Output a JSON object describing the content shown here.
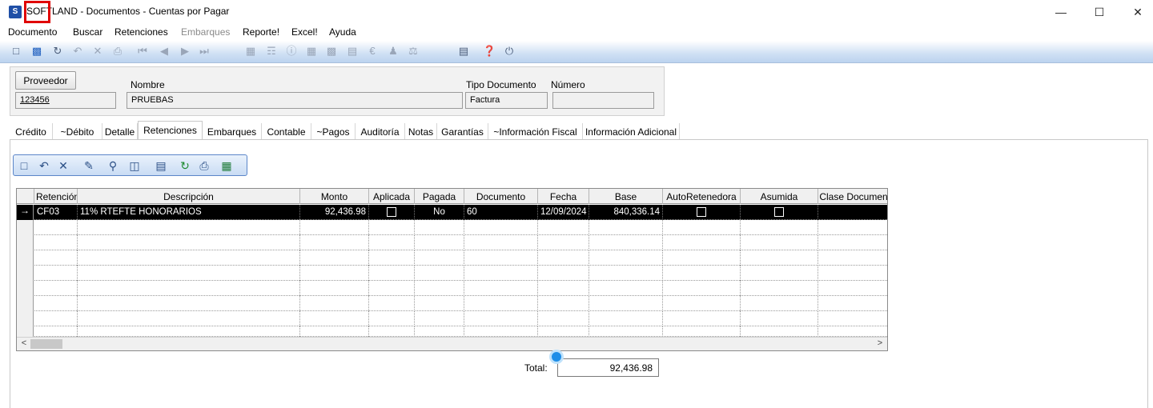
{
  "window": {
    "title": "SOFTLAND - Documentos - Cuentas por Pagar",
    "app_icon": "S",
    "controls": {
      "minimize": "—",
      "maximize": "☐",
      "close": "✕"
    }
  },
  "menu": [
    "Documento",
    "Buscar",
    "Retenciones",
    "Embarques",
    "Reporte!",
    "Excel!",
    "Ayuda"
  ],
  "toolbar_icons": [
    "new-document-icon",
    "save-icon",
    "refresh-icon",
    "undo-icon",
    "delete-icon",
    "print-preview-icon",
    "first-record-icon",
    "previous-record-icon",
    "next-record-icon",
    "last-record-icon",
    "calculator-icon",
    "tree-icon",
    "info-icon",
    "grid-icon",
    "table-icon",
    "note-icon",
    "money-icon",
    "user-icon",
    "scale-icon",
    "chart-icon",
    "help-icon",
    "power-icon"
  ],
  "header": {
    "proveedor_button": "Proveedor",
    "proveedor_value": "123456",
    "nombre_label": "Nombre",
    "nombre_value": "PRUEBAS",
    "tipo_label": "Tipo Documento",
    "tipo_value": "Factura",
    "numero_label": "Número",
    "numero_value": ""
  },
  "tabs": [
    "Crédito",
    "~Débito",
    "Detalle",
    "Retenciones",
    "Embarques",
    "Contable",
    "~Pagos",
    "Auditoría",
    "Notas",
    "Garantías",
    "~Información Fiscal",
    "Información Adicional"
  ],
  "active_tab": "Retenciones",
  "grid": {
    "columns": [
      "Retención",
      "Descripción",
      "Monto",
      "Aplicada",
      "Pagada",
      "Documento",
      "Fecha",
      "Base",
      "AutoRetenedora",
      "Asumida",
      "Clase Documen"
    ],
    "rows": [
      {
        "marker": "→",
        "retencion": "CF03",
        "descripcion": "11% RTEFTE HONORARIOS",
        "monto": "92,436.98",
        "pagada": "No",
        "documento": "60",
        "fecha": "12/09/2024",
        "base": "840,336.14"
      }
    ],
    "scroll_left": "<",
    "scroll_right": ">"
  },
  "total": {
    "label": "Total:",
    "value": "92,436.98"
  }
}
